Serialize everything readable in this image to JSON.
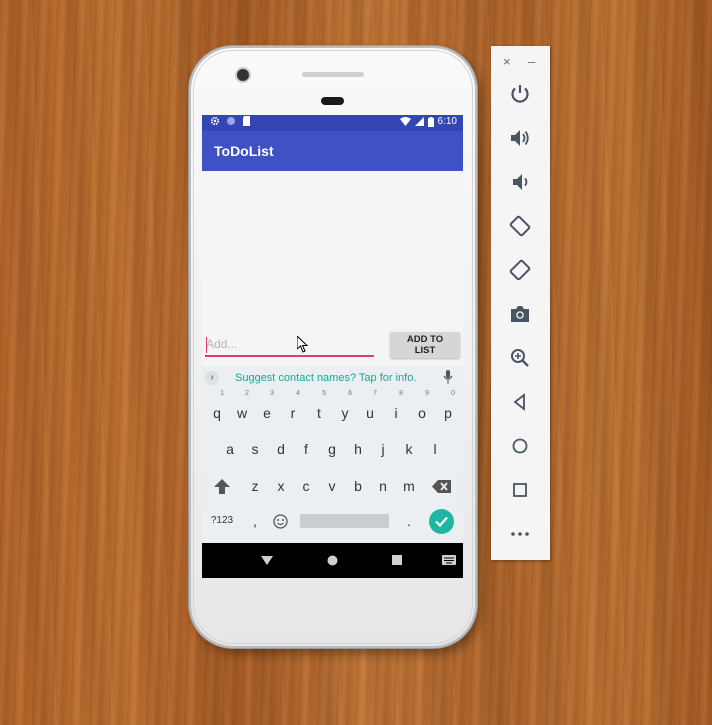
{
  "status_bar": {
    "time": "6:10"
  },
  "app": {
    "title": "ToDoList"
  },
  "form": {
    "placeholder": "Add...",
    "add_button": "ADD TO LIST"
  },
  "keyboard": {
    "suggestion": "Suggest contact names? Tap for info.",
    "row1": [
      {
        "key": "q",
        "hint": "1"
      },
      {
        "key": "w",
        "hint": "2"
      },
      {
        "key": "e",
        "hint": "3"
      },
      {
        "key": "r",
        "hint": "4"
      },
      {
        "key": "t",
        "hint": "5"
      },
      {
        "key": "y",
        "hint": "6"
      },
      {
        "key": "u",
        "hint": "7"
      },
      {
        "key": "i",
        "hint": "8"
      },
      {
        "key": "o",
        "hint": "9"
      },
      {
        "key": "p",
        "hint": "0"
      }
    ],
    "row2": [
      "a",
      "s",
      "d",
      "f",
      "g",
      "h",
      "j",
      "k",
      "l"
    ],
    "row3": [
      "z",
      "x",
      "c",
      "v",
      "b",
      "n",
      "m"
    ],
    "row4": {
      "symbols": "?123",
      "comma": ",",
      "period": "."
    }
  },
  "emulator_panel": {
    "close": "×",
    "minimize": "–",
    "buttons": [
      "power-icon",
      "volume-up-icon",
      "volume-down-icon",
      "rotate-left-icon",
      "rotate-right-icon",
      "camera-icon",
      "zoom-icon",
      "back-icon",
      "home-icon",
      "overview-icon",
      "more-icon"
    ]
  },
  "colors": {
    "primary": "#3f51c5",
    "primary_dark": "#3346b4",
    "accent": "#e23a78",
    "suggest": "#19a598",
    "enter_key": "#1db6a5"
  }
}
